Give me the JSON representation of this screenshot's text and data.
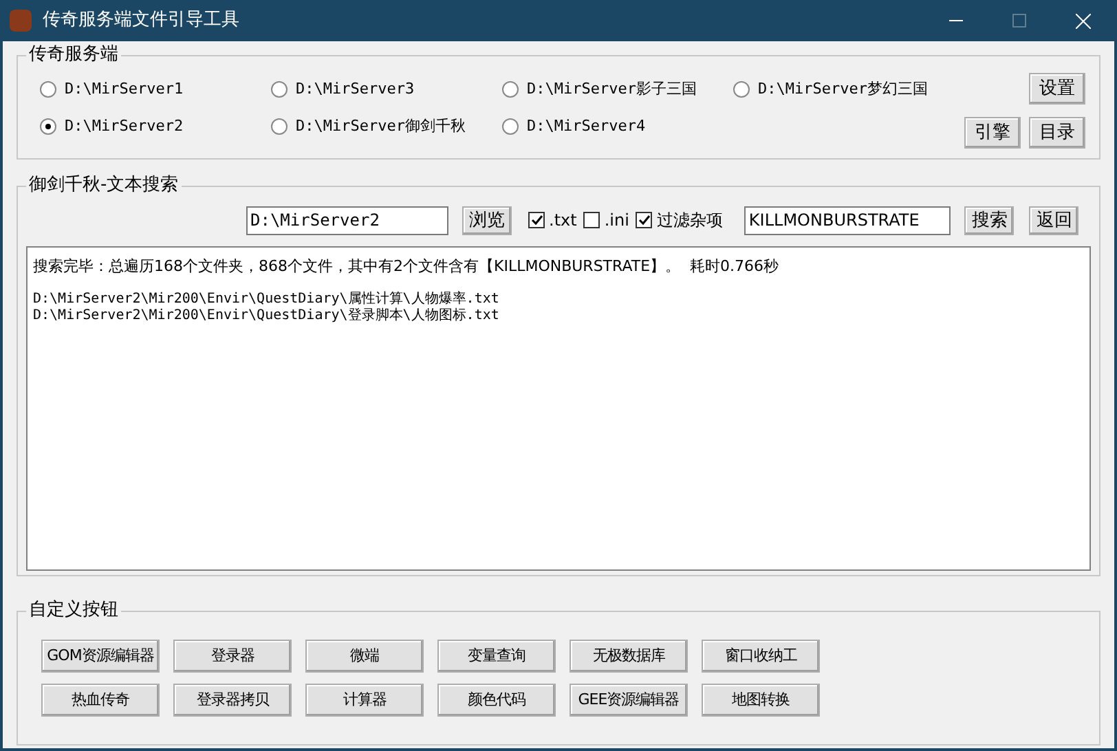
{
  "window": {
    "title": "传奇服务端文件引导工具"
  },
  "server_group": {
    "title": "传奇服务端",
    "servers": [
      {
        "label": "D:\\MirServer1",
        "selected": false
      },
      {
        "label": "D:\\MirServer3",
        "selected": false
      },
      {
        "label": "D:\\MirServer影子三国",
        "selected": false
      },
      {
        "label": "D:\\MirServer梦幻三国",
        "selected": false
      },
      {
        "label": "D:\\MirServer2",
        "selected": true
      },
      {
        "label": "D:\\MirServer御剑千秋",
        "selected": false
      },
      {
        "label": "D:\\MirServer4",
        "selected": false
      }
    ],
    "settings_button": "设置",
    "engine_button": "引擎",
    "directory_button": "目录"
  },
  "search_group": {
    "title": "御剑千秋-文本搜索",
    "path_field": "D:\\MirServer2",
    "browse_button": "浏览",
    "filters": [
      {
        "label": ".txt",
        "checked": true
      },
      {
        "label": ".ini",
        "checked": false
      },
      {
        "label": "过滤杂项",
        "checked": true
      }
    ],
    "keyword_field": "KILLMONBURSTRATE",
    "search_button": "搜索",
    "back_button": "返回",
    "summary": "搜索完毕：总遍历168个文件夹，868个文件，其中有2个文件含有【KILLMONBURSTRATE】。  耗时0.766秒",
    "results": [
      "D:\\MirServer2\\Mir200\\Envir\\QuestDiary\\属性计算\\人物爆率.txt",
      "D:\\MirServer2\\Mir200\\Envir\\QuestDiary\\登录脚本\\人物图标.txt"
    ]
  },
  "custom_group": {
    "title": "自定义按钮",
    "rows": [
      [
        "GOM资源编辑器",
        "登录器",
        "微端",
        "变量查询",
        "无极数据库",
        "窗口收纳工"
      ],
      [
        "热血传奇",
        "登录器拷贝",
        "计算器",
        "颜色代码",
        "GEE资源编辑器",
        "地图转换"
      ]
    ]
  }
}
